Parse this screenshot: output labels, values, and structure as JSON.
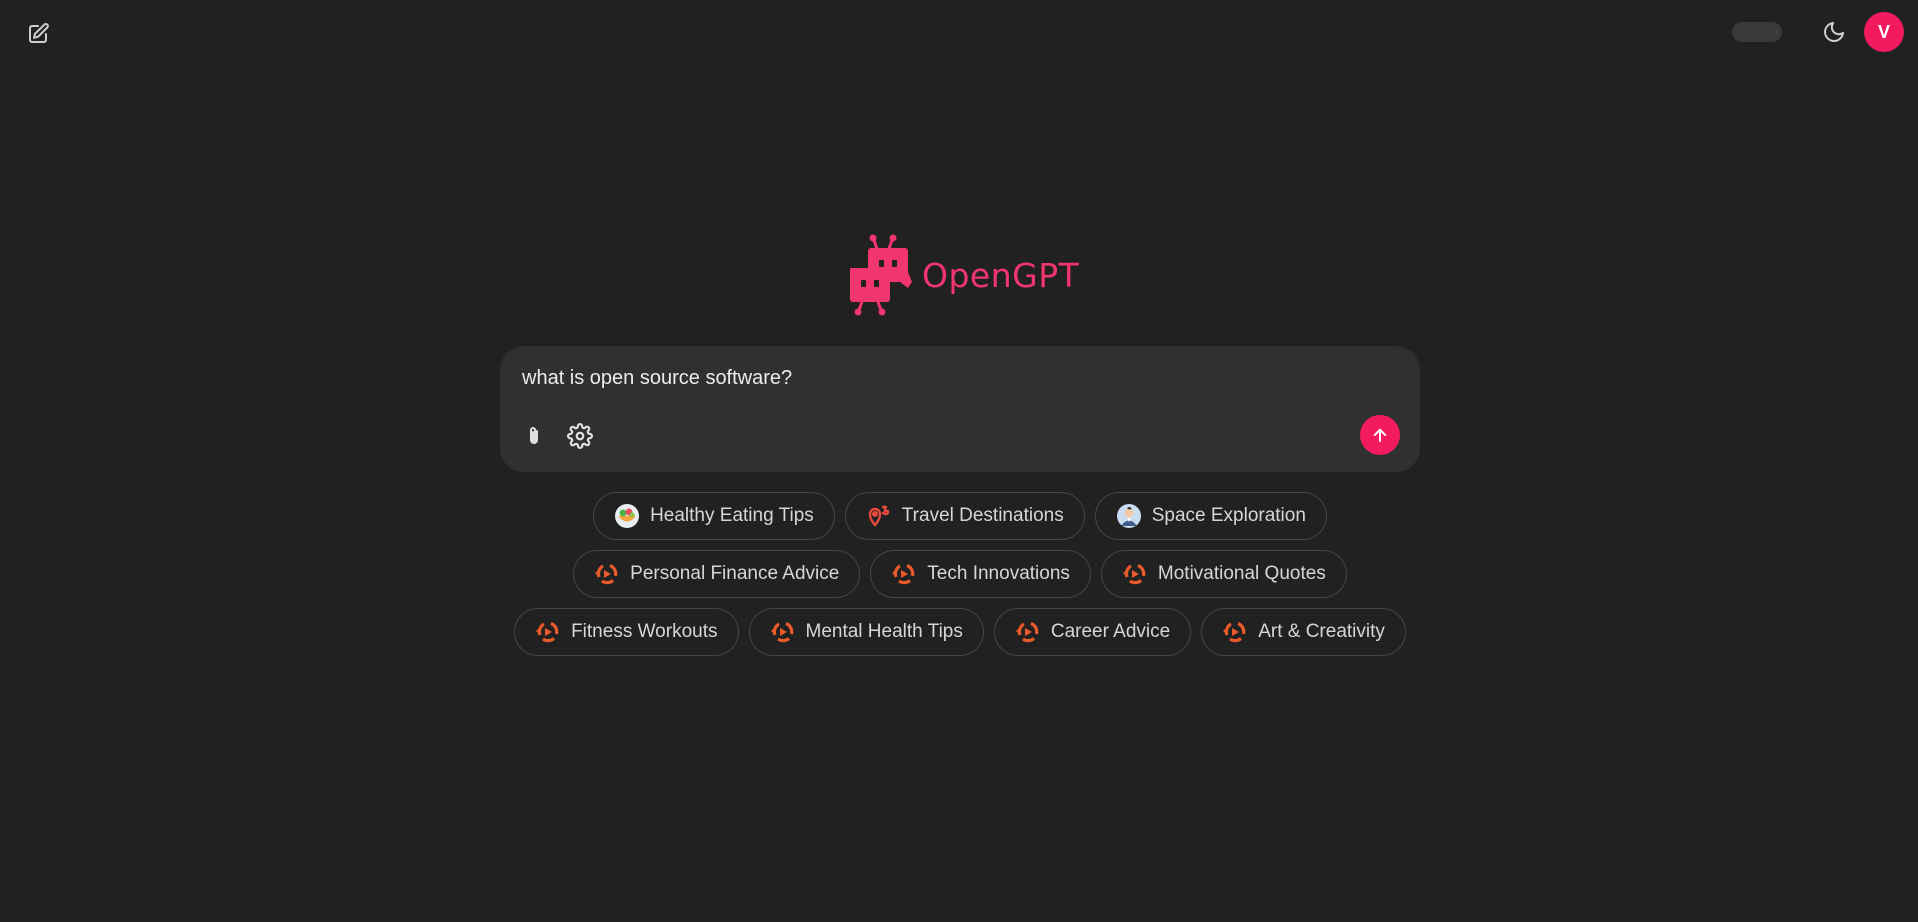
{
  "app": {
    "name": "OpenGPT"
  },
  "header": {
    "new_chat_icon": "pencil-square-icon",
    "theme_icon": "moon-icon",
    "avatar_initial": "V",
    "accent_color": "#f21b60"
  },
  "composer": {
    "value": "what is open source software?",
    "attach_icon": "paperclip-icon",
    "settings_icon": "gear-icon",
    "send_icon": "arrow-up-icon"
  },
  "suggestions": [
    [
      {
        "label": "Healthy Eating Tips",
        "icon": "salad-bowl-icon"
      },
      {
        "label": "Travel Destinations",
        "icon": "map-pin-icon"
      },
      {
        "label": "Space Exploration",
        "icon": "astronaut-avatar-icon"
      }
    ],
    [
      {
        "label": "Personal Finance Advice",
        "icon": "app-logo-icon"
      },
      {
        "label": "Tech Innovations",
        "icon": "app-logo-icon"
      },
      {
        "label": "Motivational Quotes",
        "icon": "app-logo-icon"
      }
    ],
    [
      {
        "label": "Fitness Workouts",
        "icon": "app-logo-icon"
      },
      {
        "label": "Mental Health Tips",
        "icon": "app-logo-icon"
      },
      {
        "label": "Career Advice",
        "icon": "app-logo-icon"
      },
      {
        "label": "Art & Creativity",
        "icon": "app-logo-icon"
      }
    ]
  ]
}
